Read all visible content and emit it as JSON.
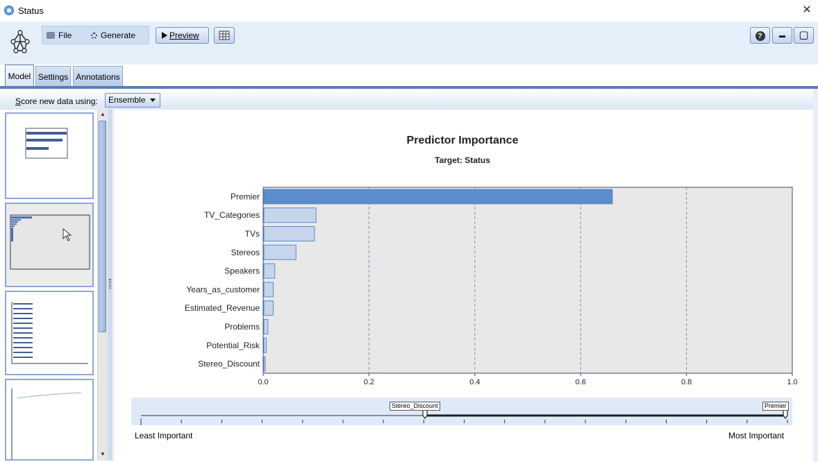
{
  "window": {
    "title": "Status",
    "close_glyph": "✕"
  },
  "toolbar": {
    "file_label": "File",
    "generate_label": "Generate",
    "preview_label": "Preview",
    "help_glyph": "?",
    "minimize_glyph": "▬",
    "maximize_glyph": "▢"
  },
  "tabs": [
    {
      "label": "Model",
      "active": true
    },
    {
      "label": "Settings",
      "active": false
    },
    {
      "label": "Annotations",
      "active": false
    }
  ],
  "score": {
    "label_prefix": "S",
    "label_rest": "core new data using:",
    "selected": "Ensemble"
  },
  "chart": {
    "title": "Predictor Importance",
    "subtitle": "Target: Status"
  },
  "chart_data": {
    "type": "bar",
    "orientation": "horizontal",
    "categories": [
      "Premier",
      "TV_Categories",
      "TVs",
      "Stereos",
      "Speakers",
      "Years_as_customer",
      "Estimated_Revenue",
      "Problems",
      "Potential_Risk",
      "Stereo_Discount"
    ],
    "values": [
      0.66,
      0.1,
      0.097,
      0.062,
      0.022,
      0.019,
      0.019,
      0.009,
      0.006,
      0.004
    ],
    "title": "Predictor Importance",
    "subtitle": "Target: Status",
    "xlim": [
      0,
      1.0
    ],
    "xticks": [
      "0.0",
      "0.2",
      "0.4",
      "0.6",
      "0.8",
      "1.0"
    ],
    "grid": "vertical dashed",
    "colors": {
      "top_bar": "#5b8ccb",
      "other_bars": "#c4d5ec",
      "bar_stroke": "#5b8ccb",
      "plot_bg": "#e9e8e8"
    }
  },
  "slider": {
    "min_label": "Stereo_Discount",
    "max_label": "Premier",
    "least_label": "Least Important",
    "most_label": "Most Important"
  },
  "colors": {
    "accent": "#5a7fb6",
    "toolbar_bg": "#e5effa"
  }
}
